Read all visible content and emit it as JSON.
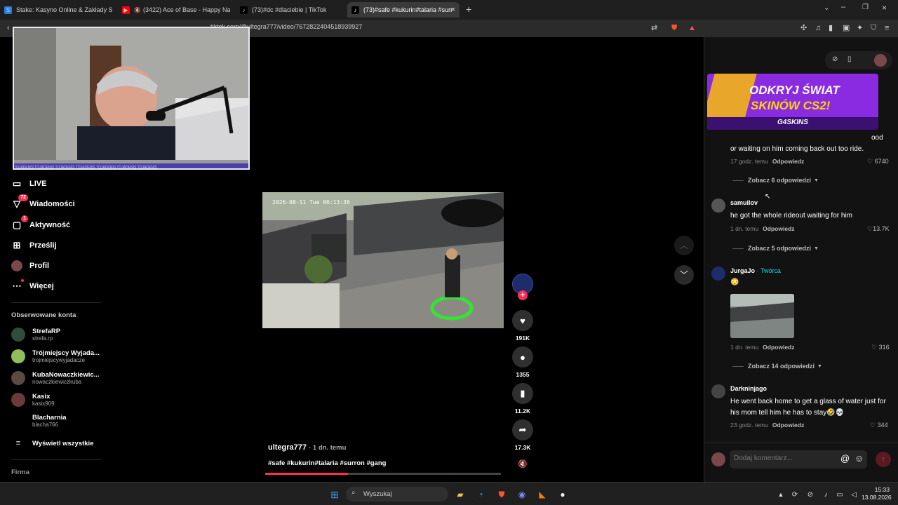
{
  "tabs": [
    {
      "title": "Stake: Kasyno Online & Zakłady Spo",
      "icon": "stake-icon",
      "color": "#2a7de1"
    },
    {
      "title": "(3422) Ace of Base - Happy Natio",
      "icon": "youtube-icon",
      "color": "#ff0000"
    },
    {
      "title": "(73)#dc #dlaciebie | TikTok",
      "icon": "tiktok-icon",
      "color": "#000000"
    },
    {
      "title": "(73)#safe #kukurin#talaria #surr",
      "icon": "tiktok-icon",
      "color": "#000000"
    }
  ],
  "address": {
    "url": "tiktok.com/@ultegra777/video/7672822404518939927"
  },
  "sidebar": {
    "nav": [
      {
        "label": "LIVE",
        "icon": "live-icon",
        "badge": ""
      },
      {
        "label": "Wiadomości",
        "icon": "messages-icon",
        "badge": "72"
      },
      {
        "label": "Aktywność",
        "icon": "activity-icon",
        "badge": "1"
      },
      {
        "label": "Prześlij",
        "icon": "upload-icon",
        "badge": ""
      },
      {
        "label": "Profil",
        "icon": "profile-icon",
        "badge": ""
      },
      {
        "label": "Więcej",
        "icon": "more-icon",
        "badge": ""
      }
    ],
    "following_title": "Obserwowane konta",
    "accounts": [
      {
        "name": "StrefaRP",
        "handle": "strefa.rp",
        "color": "#2e4d3a"
      },
      {
        "name": "Trójmiejscy Wyjada...",
        "handle": "trojmiejscywyjadacze",
        "color": "#8fbf5a"
      },
      {
        "name": "KubaNowaczkiewic...",
        "handle": "nowaczkiewiczkuba",
        "color": "#5a4a40"
      },
      {
        "name": "Kasix",
        "handle": "kasix909",
        "color": "#6b3b3b"
      },
      {
        "name": "Blacharnia",
        "handle": "blacha766",
        "color": "#000000"
      }
    ],
    "show_all": "Wyświetl wszystkie",
    "footer": "Firma"
  },
  "video": {
    "timestamp": "2026-08-11 Tue 06:13:36",
    "author": "ultegra777",
    "age": "· 1 dn. temu",
    "caption": "#safe #kukurin#talaria #surron #gang",
    "progress": 0.35
  },
  "actions": [
    {
      "name": "like",
      "icon": "heart-icon",
      "count": "191K"
    },
    {
      "name": "comment",
      "icon": "comment-icon",
      "count": "1355"
    },
    {
      "name": "save",
      "icon": "bookmark-icon",
      "count": "11.2K"
    },
    {
      "name": "share",
      "icon": "share-icon",
      "count": "17.3K"
    }
  ],
  "ad": {
    "line1": "ODKRYJ ŚWIAT",
    "line2": "SKINÓW CS2!",
    "brand": "G4SKINS"
  },
  "comments": [
    {
      "id": "c1",
      "user": "",
      "text": "or waiting on him coming back out too ride.",
      "text_prefix": "ood",
      "time": "17 godz. temu",
      "reply": "Odpowiedz",
      "likes": "6740",
      "more": "Zobacz 6 odpowiedzi"
    },
    {
      "id": "c2",
      "user": "samuilov",
      "text": "he got the whole rideout waiting for him",
      "time": "1 dn. temu",
      "reply": "Odpowiedz",
      "likes": "13.7K",
      "more": "Zobacz 5 odpowiedzi"
    },
    {
      "id": "c3",
      "user": "JurgaJo",
      "creator": "· Twórca",
      "text": "",
      "time": "1 dn. temu",
      "reply": "Odpowiedz",
      "likes": "316",
      "more": "Zobacz 14 odpowiedzi"
    },
    {
      "id": "c4",
      "user": "Darkninjago",
      "text": "He went back home to get a glass of water just for his mom tell him he has to stay🤣💀",
      "time": "23 godz. temu",
      "reply": "Odpowiedz",
      "likes": "344",
      "more": ""
    }
  ],
  "comment_input": {
    "placeholder": "Dodaj komentarz..."
  },
  "taskbar": {
    "search": "Wyszukaj",
    "time": "15:33",
    "date": "13.08.2026"
  },
  "webcam": {
    "banner": "TOJADENIS TOJADENIS TOJADENIS TOJADENIS TOJADENIS TOJADENIS TOJADENIS"
  }
}
